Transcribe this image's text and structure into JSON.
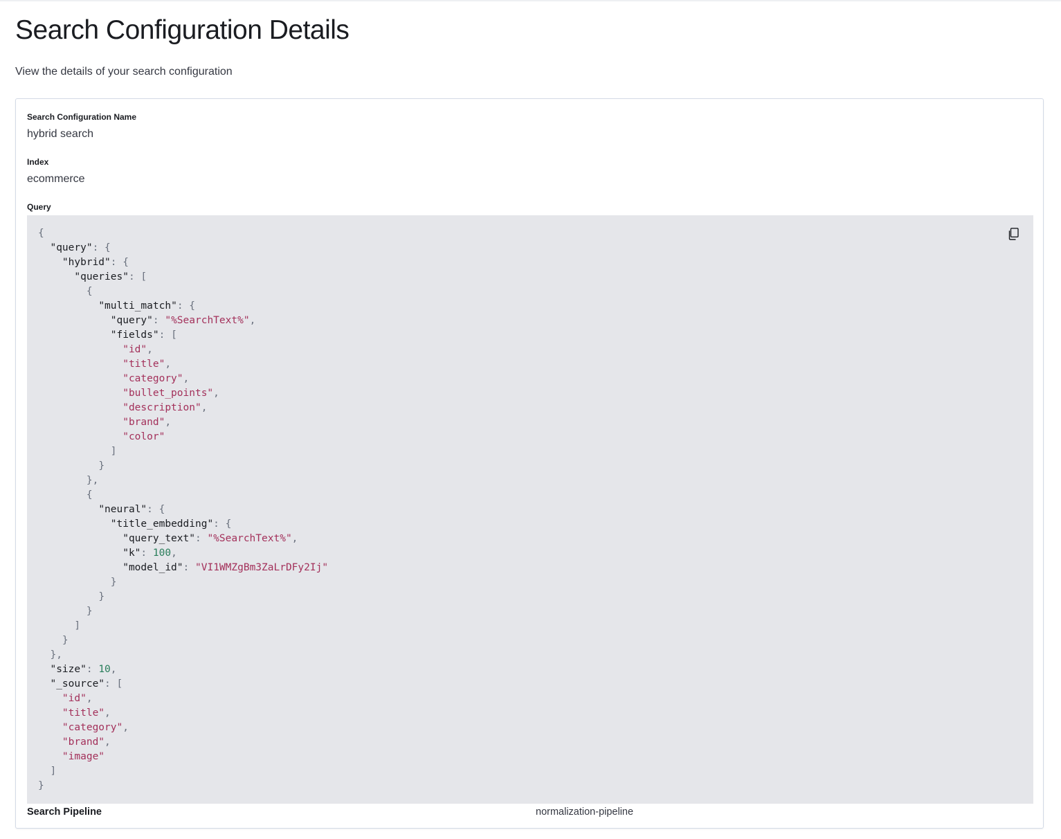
{
  "page": {
    "title": "Search Configuration Details",
    "subtitle": "View the details of your search configuration"
  },
  "fields": {
    "name": {
      "label": "Search Configuration Name",
      "value": "hybrid search"
    },
    "index": {
      "label": "Index",
      "value": "ecommerce"
    },
    "query": {
      "label": "Query",
      "copy_icon": "copy-icon",
      "code_lines": [
        [
          [
            "p",
            "{"
          ]
        ],
        [
          [
            "w",
            "  "
          ],
          [
            "k",
            "\"query\""
          ],
          [
            "p",
            ": {"
          ]
        ],
        [
          [
            "w",
            "    "
          ],
          [
            "k",
            "\"hybrid\""
          ],
          [
            "p",
            ": {"
          ]
        ],
        [
          [
            "w",
            "      "
          ],
          [
            "k",
            "\"queries\""
          ],
          [
            "p",
            ": ["
          ]
        ],
        [
          [
            "w",
            "        "
          ],
          [
            "p",
            "{"
          ]
        ],
        [
          [
            "w",
            "          "
          ],
          [
            "k",
            "\"multi_match\""
          ],
          [
            "p",
            ": {"
          ]
        ],
        [
          [
            "w",
            "            "
          ],
          [
            "k",
            "\"query\""
          ],
          [
            "p",
            ": "
          ],
          [
            "s",
            "\"%SearchText%\""
          ],
          [
            "p",
            ","
          ]
        ],
        [
          [
            "w",
            "            "
          ],
          [
            "k",
            "\"fields\""
          ],
          [
            "p",
            ": ["
          ]
        ],
        [
          [
            "w",
            "              "
          ],
          [
            "s",
            "\"id\""
          ],
          [
            "p",
            ","
          ]
        ],
        [
          [
            "w",
            "              "
          ],
          [
            "s",
            "\"title\""
          ],
          [
            "p",
            ","
          ]
        ],
        [
          [
            "w",
            "              "
          ],
          [
            "s",
            "\"category\""
          ],
          [
            "p",
            ","
          ]
        ],
        [
          [
            "w",
            "              "
          ],
          [
            "s",
            "\"bullet_points\""
          ],
          [
            "p",
            ","
          ]
        ],
        [
          [
            "w",
            "              "
          ],
          [
            "s",
            "\"description\""
          ],
          [
            "p",
            ","
          ]
        ],
        [
          [
            "w",
            "              "
          ],
          [
            "s",
            "\"brand\""
          ],
          [
            "p",
            ","
          ]
        ],
        [
          [
            "w",
            "              "
          ],
          [
            "s",
            "\"color\""
          ]
        ],
        [
          [
            "w",
            "            "
          ],
          [
            "p",
            "]"
          ]
        ],
        [
          [
            "w",
            "          "
          ],
          [
            "p",
            "}"
          ]
        ],
        [
          [
            "w",
            "        "
          ],
          [
            "p",
            "},"
          ]
        ],
        [
          [
            "w",
            "        "
          ],
          [
            "p",
            "{"
          ]
        ],
        [
          [
            "w",
            "          "
          ],
          [
            "k",
            "\"neural\""
          ],
          [
            "p",
            ": {"
          ]
        ],
        [
          [
            "w",
            "            "
          ],
          [
            "k",
            "\"title_embedding\""
          ],
          [
            "p",
            ": {"
          ]
        ],
        [
          [
            "w",
            "              "
          ],
          [
            "k",
            "\"query_text\""
          ],
          [
            "p",
            ": "
          ],
          [
            "s",
            "\"%SearchText%\""
          ],
          [
            "p",
            ","
          ]
        ],
        [
          [
            "w",
            "              "
          ],
          [
            "k",
            "\"k\""
          ],
          [
            "p",
            ": "
          ],
          [
            "n",
            "100"
          ],
          [
            "p",
            ","
          ]
        ],
        [
          [
            "w",
            "              "
          ],
          [
            "k",
            "\"model_id\""
          ],
          [
            "p",
            ": "
          ],
          [
            "s",
            "\"VI1WMZgBm3ZaLrDFy2Ij\""
          ]
        ],
        [
          [
            "w",
            "            "
          ],
          [
            "p",
            "}"
          ]
        ],
        [
          [
            "w",
            "          "
          ],
          [
            "p",
            "}"
          ]
        ],
        [
          [
            "w",
            "        "
          ],
          [
            "p",
            "}"
          ]
        ],
        [
          [
            "w",
            "      "
          ],
          [
            "p",
            "]"
          ]
        ],
        [
          [
            "w",
            "    "
          ],
          [
            "p",
            "}"
          ]
        ],
        [
          [
            "w",
            "  "
          ],
          [
            "p",
            "},"
          ]
        ],
        [
          [
            "w",
            "  "
          ],
          [
            "k",
            "\"size\""
          ],
          [
            "p",
            ": "
          ],
          [
            "n",
            "10"
          ],
          [
            "p",
            ","
          ]
        ],
        [
          [
            "w",
            "  "
          ],
          [
            "k",
            "\"_source\""
          ],
          [
            "p",
            ": ["
          ]
        ],
        [
          [
            "w",
            "    "
          ],
          [
            "s",
            "\"id\""
          ],
          [
            "p",
            ","
          ]
        ],
        [
          [
            "w",
            "    "
          ],
          [
            "s",
            "\"title\""
          ],
          [
            "p",
            ","
          ]
        ],
        [
          [
            "w",
            "    "
          ],
          [
            "s",
            "\"category\""
          ],
          [
            "p",
            ","
          ]
        ],
        [
          [
            "w",
            "    "
          ],
          [
            "s",
            "\"brand\""
          ],
          [
            "p",
            ","
          ]
        ],
        [
          [
            "w",
            "    "
          ],
          [
            "s",
            "\"image\""
          ]
        ],
        [
          [
            "w",
            "  "
          ],
          [
            "p",
            "]"
          ]
        ],
        [
          [
            "p",
            "}"
          ]
        ]
      ]
    },
    "pipeline": {
      "label": "Search Pipeline",
      "value": "normalization-pipeline"
    }
  },
  "colors": {
    "code_background": "#e5e6ea",
    "string": "#a3305a",
    "number": "#287d5a",
    "punctuation": "#69707d"
  }
}
